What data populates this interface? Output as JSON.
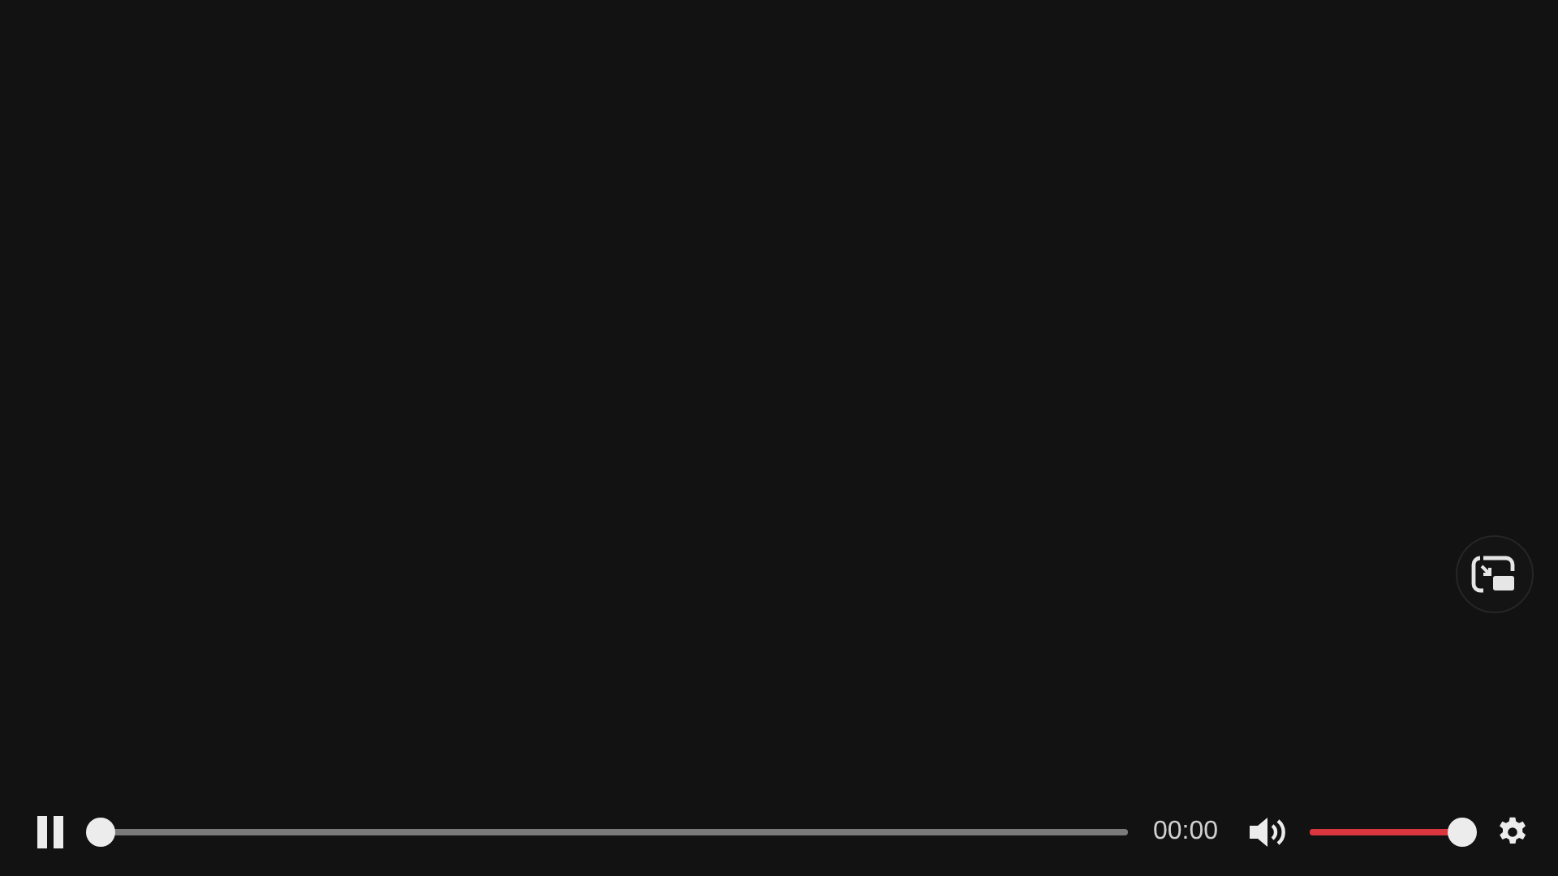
{
  "player": {
    "playing": true,
    "progress": {
      "level": 0
    },
    "time": "00:00",
    "volume": {
      "muted": false,
      "level": 1
    }
  }
}
